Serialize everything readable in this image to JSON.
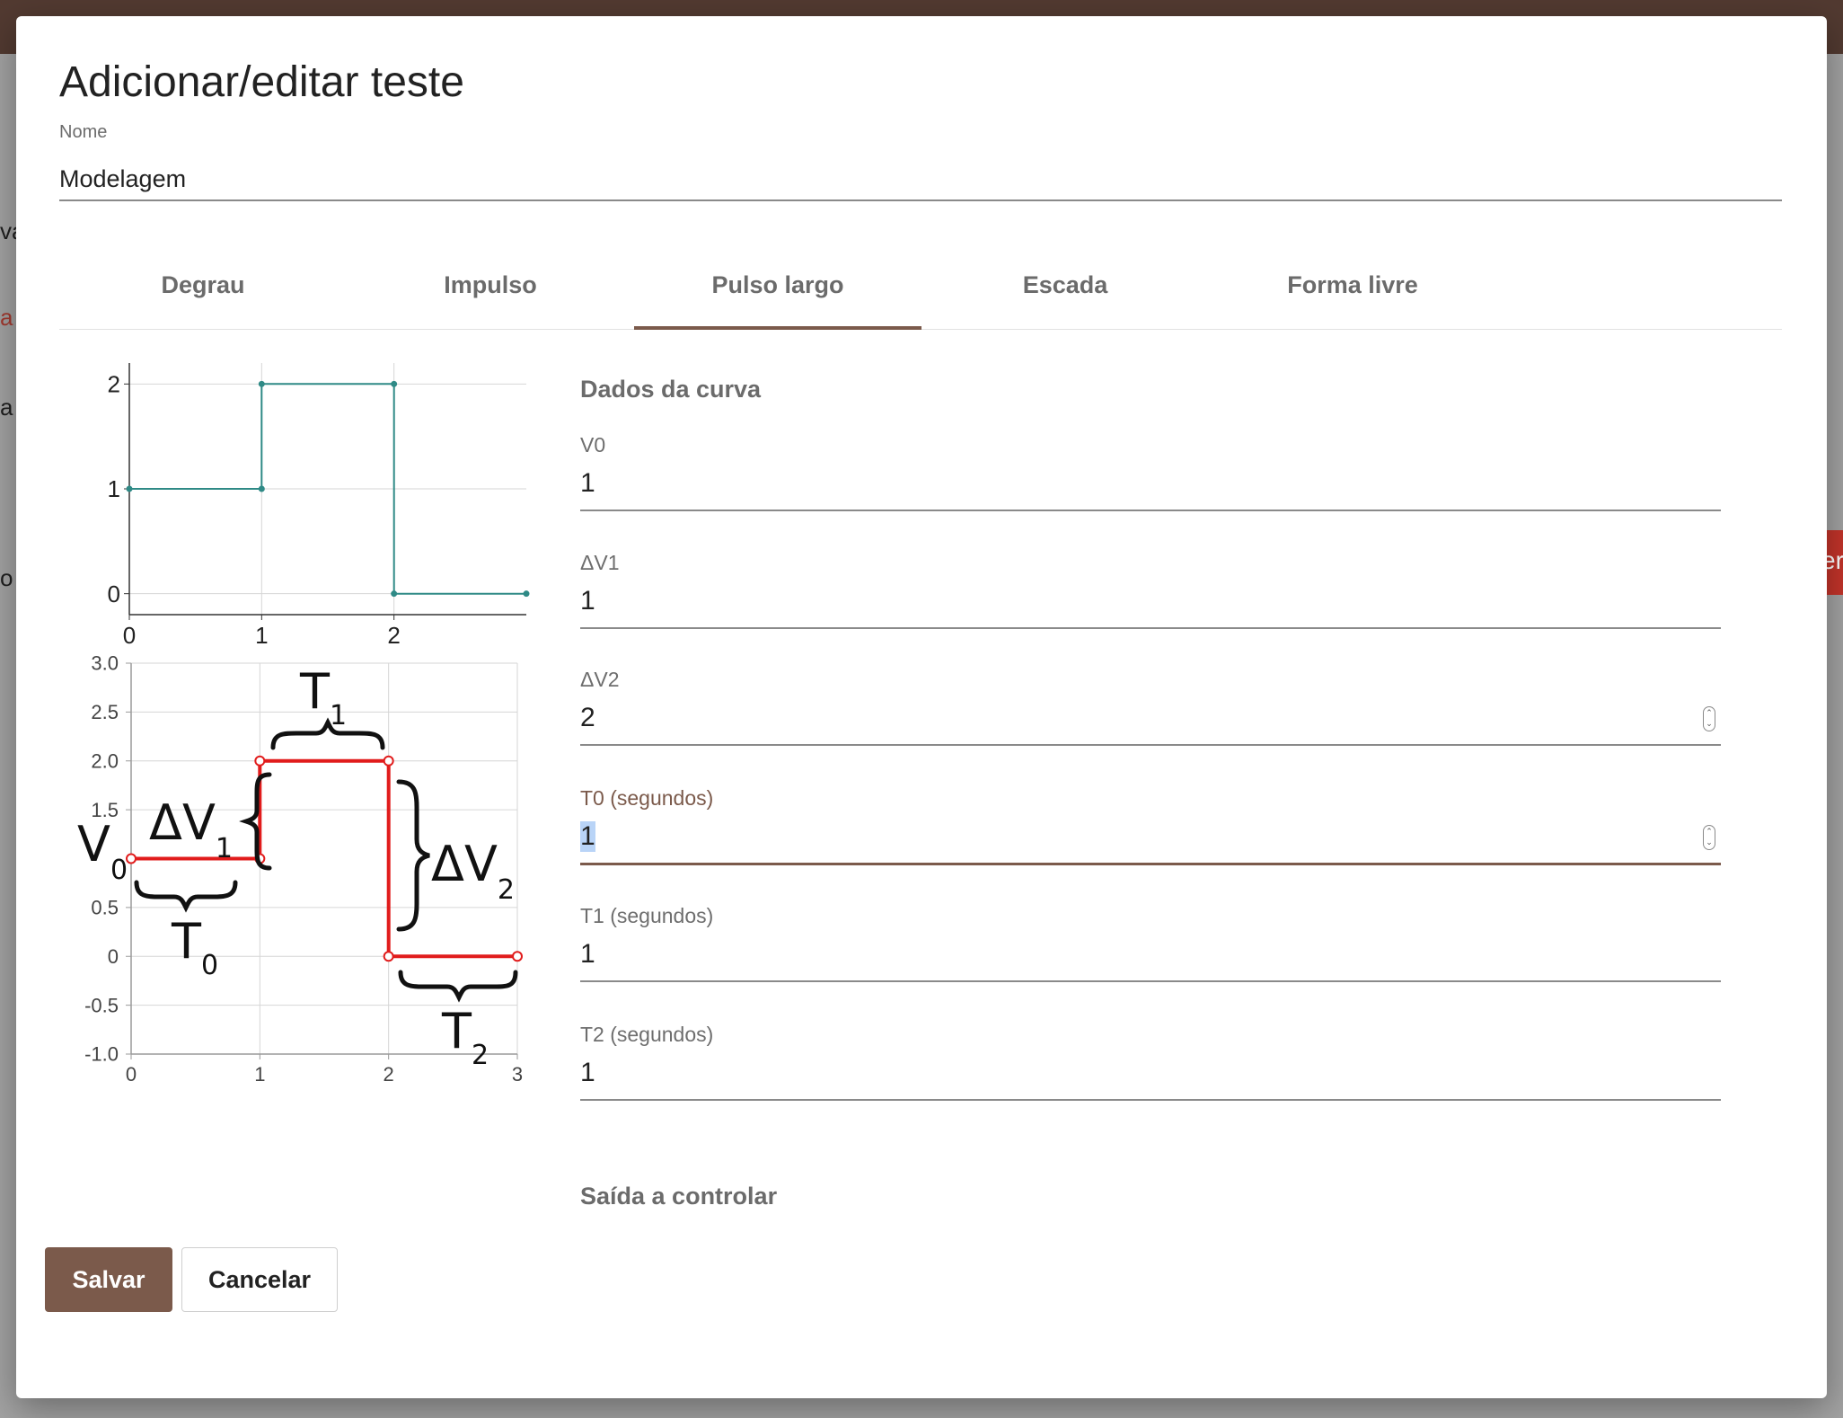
{
  "background": {
    "fragments": [
      "va",
      "a",
      "a",
      "o",
      "er"
    ]
  },
  "dialog": {
    "title": "Adicionar/editar teste",
    "name_label": "Nome",
    "name_value": "Modelagem"
  },
  "tabs": [
    {
      "label": "Degrau",
      "active": false
    },
    {
      "label": "Impulso",
      "active": false
    },
    {
      "label": "Pulso largo",
      "active": true
    },
    {
      "label": "Escada",
      "active": false
    },
    {
      "label": "Forma livre",
      "active": false
    }
  ],
  "chart_data": [
    {
      "type": "line",
      "step": true,
      "x": [
        0,
        1,
        1,
        2,
        2,
        3
      ],
      "y": [
        1,
        1,
        2,
        2,
        0,
        0
      ],
      "xlim": [
        0,
        3
      ],
      "ylim": [
        -0.2,
        2.2
      ],
      "x_ticks": [
        "0",
        "1",
        "2"
      ],
      "y_ticks": [
        "0",
        "1",
        "2"
      ],
      "grid": true,
      "color": "#2f8a86"
    },
    {
      "type": "line",
      "step": true,
      "x": [
        0,
        1,
        1,
        2,
        2,
        3
      ],
      "y": [
        1,
        1,
        2,
        2,
        0,
        0
      ],
      "xlim": [
        0,
        3
      ],
      "ylim": [
        -1.0,
        3.0
      ],
      "x_ticks": [
        "0",
        "1",
        "2",
        "3"
      ],
      "y_ticks": [
        "3.0",
        "2.5",
        "2.0",
        "1.5",
        "0.5",
        "0",
        "-0.5",
        "-1.0"
      ],
      "grid": true,
      "color": "#e11c1c",
      "annotations": {
        "V0": {
          "main": "V",
          "sub": "0"
        },
        "T0": {
          "main": "T",
          "sub": "0"
        },
        "T1": {
          "main": "T",
          "sub": "1"
        },
        "T2": {
          "main": "T",
          "sub": "2"
        },
        "dV1": {
          "main": "ΔV",
          "sub": "1"
        },
        "dV2": {
          "main": "ΔV",
          "sub": "2"
        }
      }
    }
  ],
  "curve": {
    "section_title": "Dados da curva",
    "fields": [
      {
        "label": "V0",
        "value": "1"
      },
      {
        "label": "ΔV1",
        "value": "1"
      },
      {
        "label": "ΔV2",
        "value": "2"
      },
      {
        "label": "T0 (segundos)",
        "value": "1"
      },
      {
        "label": "T1 (segundos)",
        "value": "1"
      },
      {
        "label": "T2 (segundos)",
        "value": "1"
      }
    ]
  },
  "output_section_title": "Saída a controlar",
  "buttons": {
    "save": "Salvar",
    "cancel": "Cancelar"
  }
}
